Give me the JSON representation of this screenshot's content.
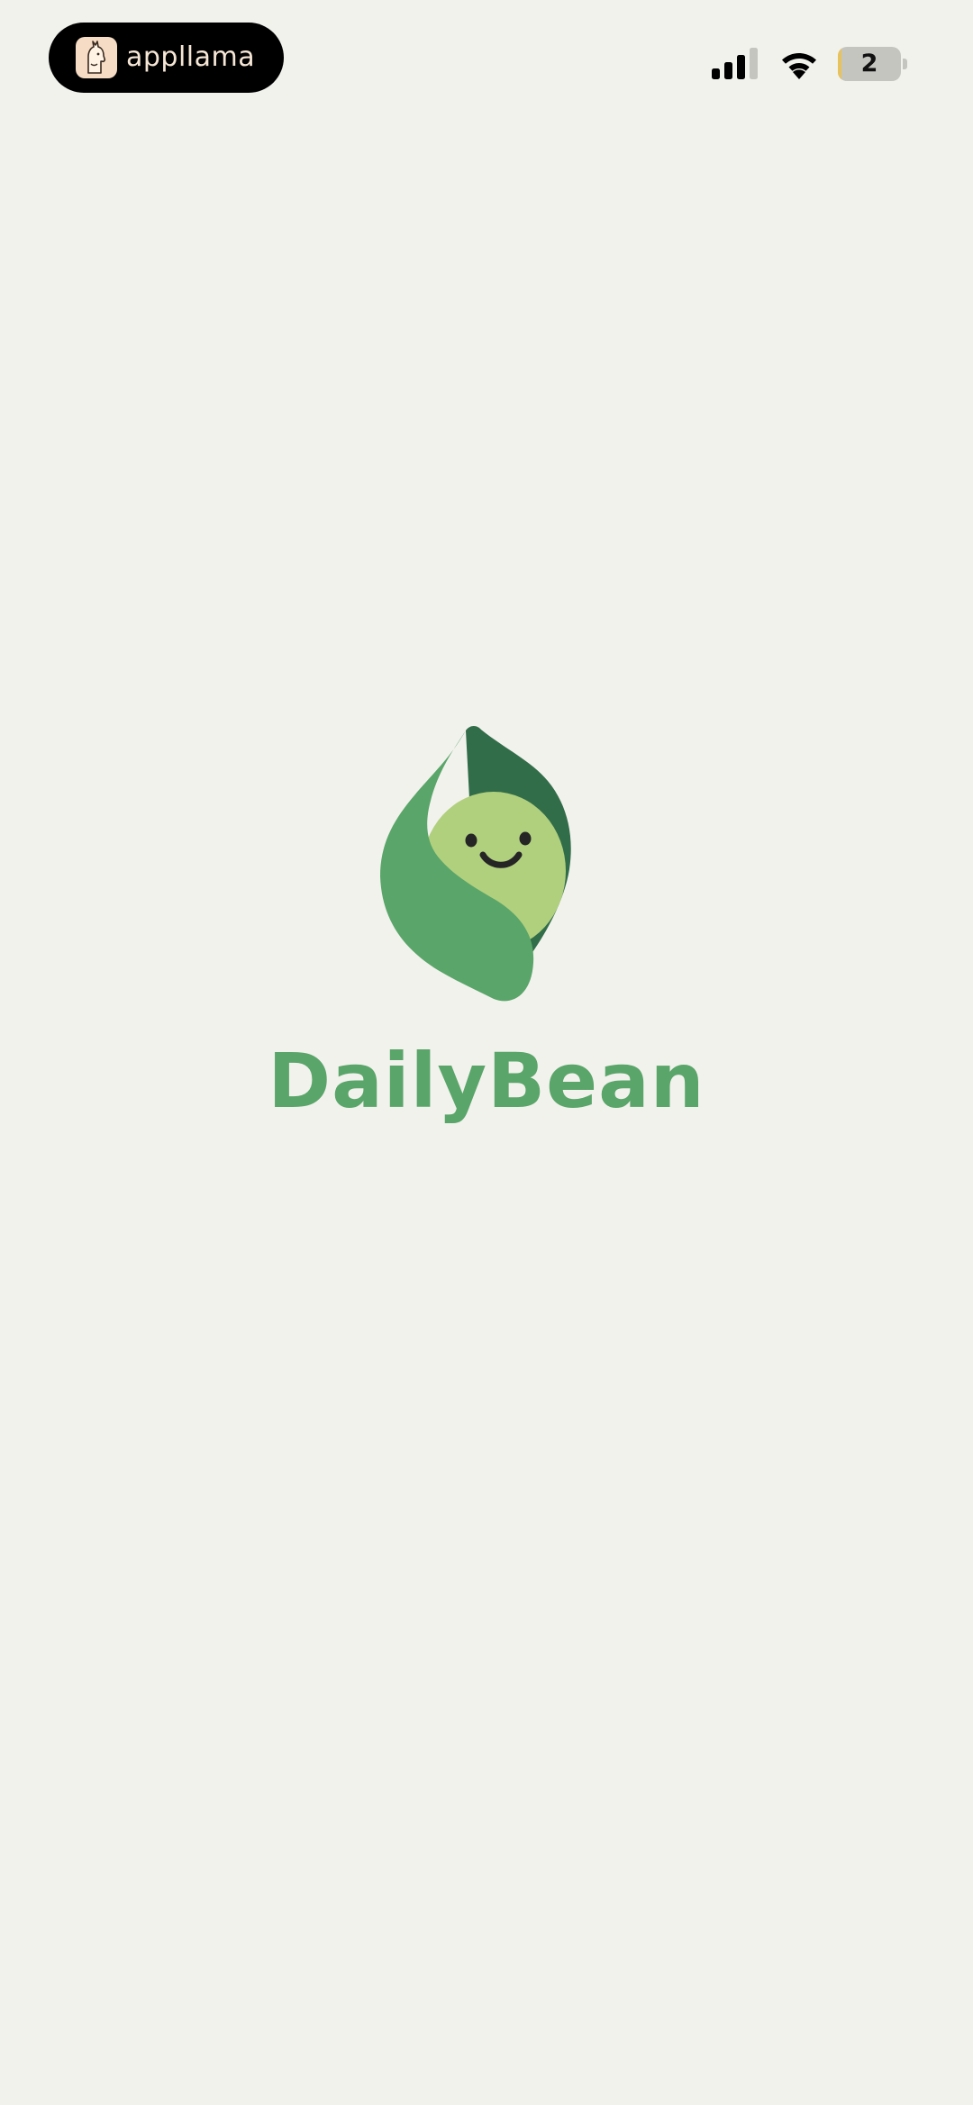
{
  "status_bar": {
    "app_badge": {
      "name": "appllama",
      "icon": "llama-icon"
    },
    "signal": {
      "icon": "cellular-signal-icon",
      "bars_filled": 3,
      "bars_total": 4
    },
    "wifi": {
      "icon": "wifi-icon"
    },
    "battery": {
      "icon": "battery-icon",
      "value": "2",
      "level_percent": 2,
      "low_color": "#E8C25A"
    }
  },
  "splash": {
    "logo": {
      "icon": "bean-pod-mascot-icon"
    },
    "title": "DailyBean"
  },
  "colors": {
    "background": "#F2F2ED",
    "brand_green": "#5AA569",
    "dark_green": "#326D49",
    "light_green": "#B0D07E"
  }
}
